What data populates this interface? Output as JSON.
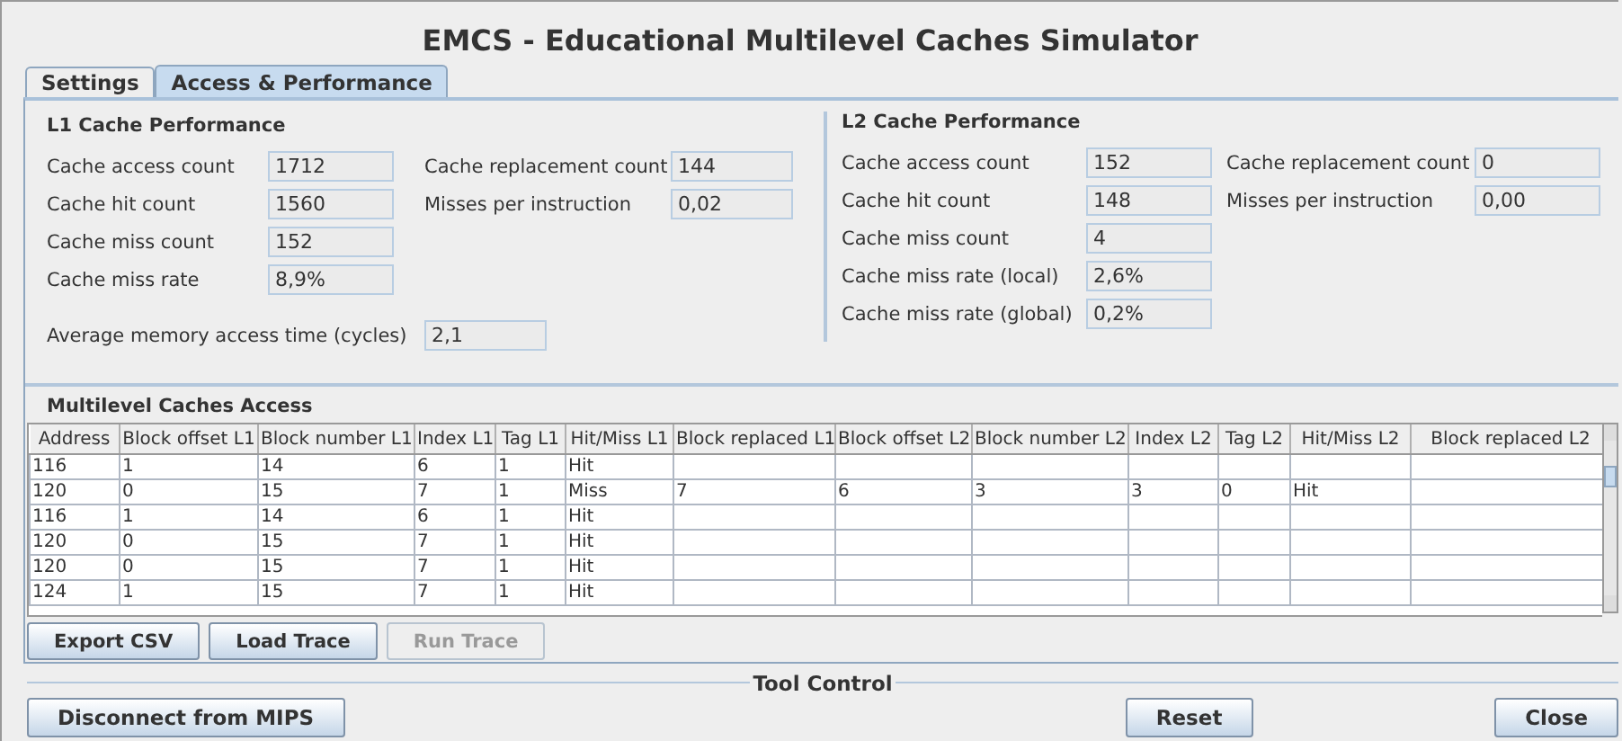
{
  "window": {
    "title": "EMCS - Educational Multilevel Caches Simulator"
  },
  "tabs": [
    {
      "label": "Settings",
      "selected": false
    },
    {
      "label": "Access & Performance",
      "selected": true
    }
  ],
  "l1": {
    "title": "L1 Cache Performance",
    "left_metrics": [
      {
        "label": "Cache access count",
        "value": "1712"
      },
      {
        "label": "Cache hit count",
        "value": "1560"
      },
      {
        "label": "Cache miss count",
        "value": "152"
      },
      {
        "label": "Cache miss rate",
        "value": "8,9%"
      }
    ],
    "right_metrics": [
      {
        "label": "Cache replacement count",
        "value": "144"
      },
      {
        "label": "Misses per instruction",
        "value": "0,02"
      }
    ],
    "extra_metrics": [
      {
        "label": "Average memory access time (cycles)",
        "value": "2,1"
      }
    ]
  },
  "l2": {
    "title": "L2 Cache Performance",
    "left_metrics": [
      {
        "label": "Cache access count",
        "value": "152"
      },
      {
        "label": "Cache hit count",
        "value": "148"
      },
      {
        "label": "Cache miss count",
        "value": "4"
      },
      {
        "label": "Cache miss rate (local)",
        "value": "2,6%"
      },
      {
        "label": "Cache miss rate (global)",
        "value": "0,2%"
      }
    ],
    "right_metrics": [
      {
        "label": "Cache replacement count",
        "value": "0"
      },
      {
        "label": "Misses per instruction",
        "value": "0,00"
      }
    ]
  },
  "table": {
    "title": "Multilevel Caches Access",
    "columns": [
      "Address",
      "Block offset L1",
      "Block number L1",
      "Index L1",
      "Tag L1",
      "Hit/Miss L1",
      "Block replaced L1",
      "Block offset L2",
      "Block number L2",
      "Index L2",
      "Tag L2",
      "Hit/Miss L2",
      "Block replaced L2"
    ],
    "rows": [
      [
        "116",
        "1",
        "14",
        "6",
        "1",
        "Hit",
        null,
        null,
        null,
        null,
        null,
        null,
        null
      ],
      [
        "120",
        "0",
        "15",
        "7",
        "1",
        "Miss",
        "7",
        "6",
        "3",
        "3",
        "0",
        "Hit",
        null
      ],
      [
        "116",
        "1",
        "14",
        "6",
        "1",
        "Hit",
        null,
        null,
        null,
        null,
        null,
        null,
        null
      ],
      [
        "120",
        "0",
        "15",
        "7",
        "1",
        "Hit",
        null,
        null,
        null,
        null,
        null,
        null,
        null
      ],
      [
        "120",
        "0",
        "15",
        "7",
        "1",
        "Hit",
        null,
        null,
        null,
        null,
        null,
        null,
        null
      ],
      [
        "124",
        "1",
        "15",
        "7",
        "1",
        "Hit",
        null,
        null,
        null,
        null,
        null,
        null,
        null
      ]
    ]
  },
  "trace_buttons": [
    {
      "label": "Export CSV",
      "disabled": false
    },
    {
      "label": "Load Trace",
      "disabled": false
    },
    {
      "label": "Run Trace",
      "disabled": true
    }
  ],
  "tool_control": {
    "title": "Tool Control",
    "buttons": [
      {
        "label": "Disconnect from MIPS"
      },
      {
        "label": "Reset"
      },
      {
        "label": "Close"
      }
    ]
  }
}
